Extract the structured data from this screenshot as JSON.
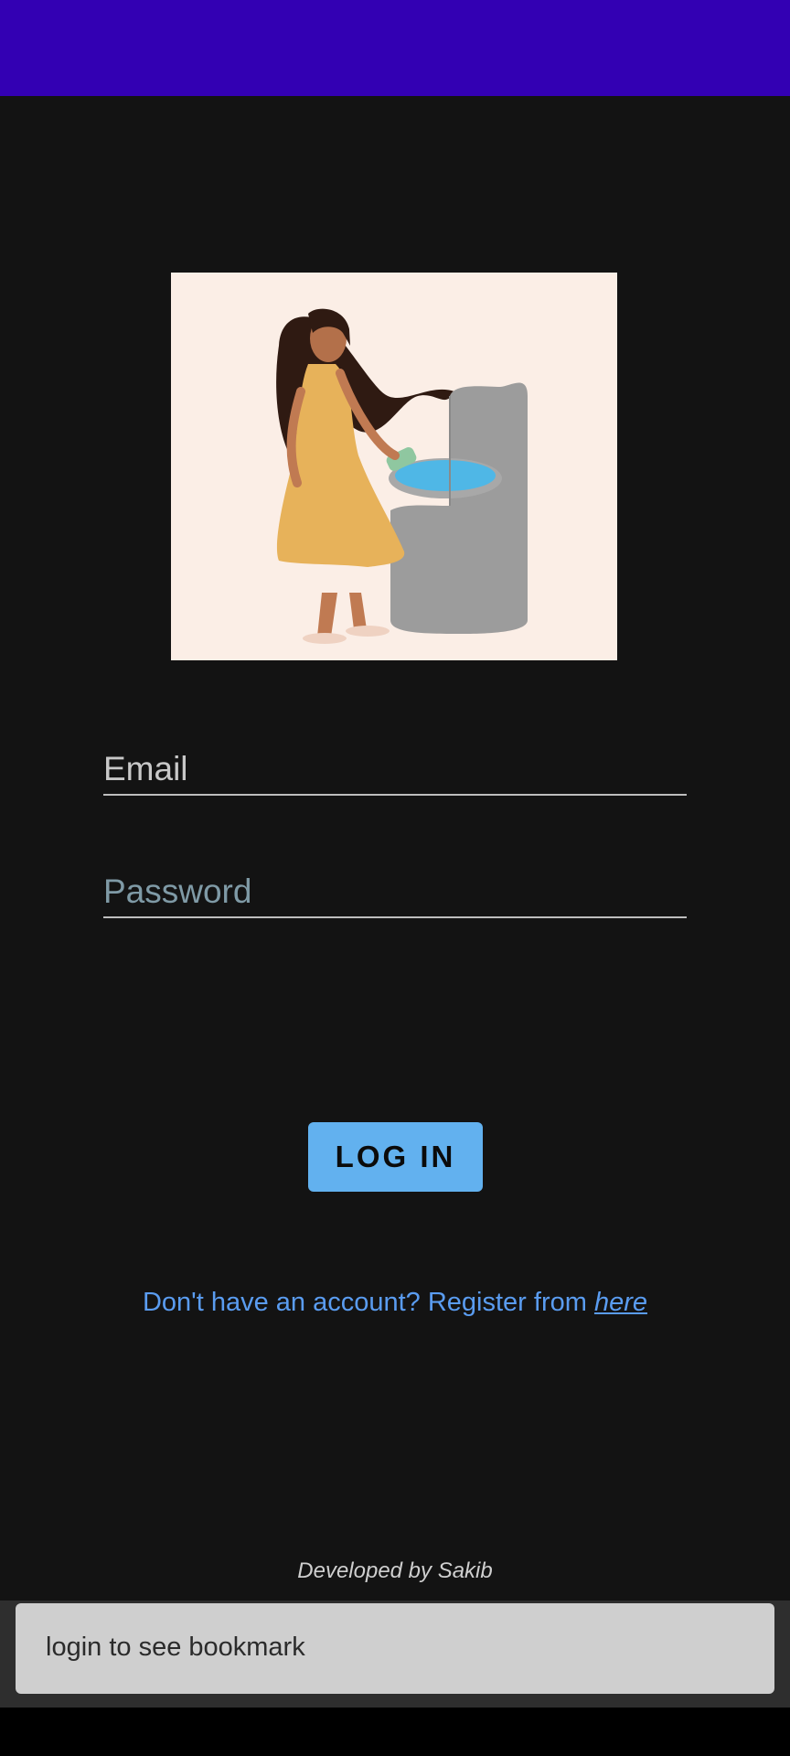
{
  "colors": {
    "status_bar": "#3300b3",
    "background": "#131313",
    "button": "#62b1ef",
    "link": "#5a9cf0",
    "snackbar": "#cfcfcf"
  },
  "hero": {
    "illustration": "woman-at-water-well-illustration"
  },
  "form": {
    "email_placeholder": "Email",
    "password_placeholder": "Password",
    "login_label": "LOG IN"
  },
  "register": {
    "prompt": "Don't have an account? Register from ",
    "link_label": "here"
  },
  "footer": {
    "credit": "Developed by Sakib"
  },
  "snackbar": {
    "message": "login to see bookmark"
  }
}
